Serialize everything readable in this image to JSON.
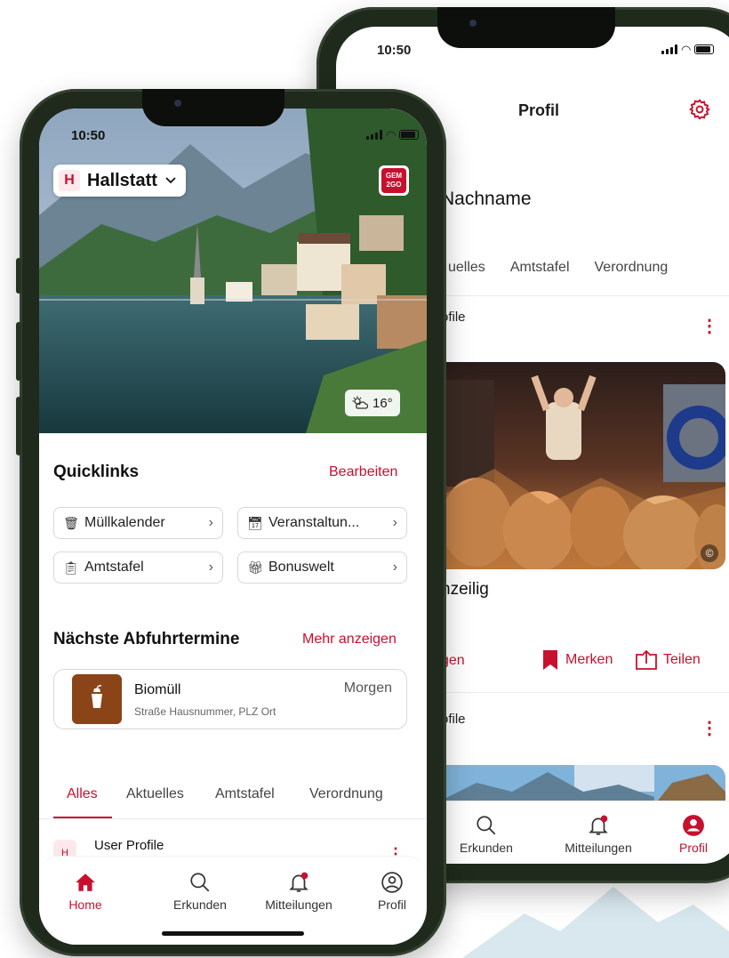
{
  "colors": {
    "accent": "#c8102e",
    "frame": "#1f2a1c",
    "waste_brown": "#8a4418"
  },
  "back_phone": {
    "status_time": "10:50",
    "header_title": "Profil",
    "name_partial": "Nachname",
    "comma_fragment": ",",
    "tabs": [
      "uelles",
      "Amtstafel",
      "Verordnung"
    ],
    "post1_label": "ofile",
    "post_headline": "nzeilig",
    "actions": {
      "left_partial": "gen",
      "bookmark_label": "Merken",
      "share_label": "Teilen"
    },
    "post2_label": "ofile",
    "copyright_symbol": "©",
    "nav": [
      {
        "label": "Erkunden",
        "icon": "search-icon"
      },
      {
        "label": "Mitteilungen",
        "icon": "bell-icon"
      },
      {
        "label": "Profil",
        "icon": "user-circle-icon"
      }
    ]
  },
  "front_phone": {
    "status_time": "10:50",
    "city": {
      "logo_letter": "H",
      "name": "Hallstatt"
    },
    "gem_badge": "GEM 2GO",
    "weather": "16°",
    "quicklinks": {
      "title": "Quicklinks",
      "edit_label": "Bearbeiten",
      "items": [
        {
          "label": "Müllkalender",
          "icon": "trash-icon"
        },
        {
          "label": "Veranstaltun...",
          "icon": "calendar-icon"
        },
        {
          "label": "Amtstafel",
          "icon": "clipboard-icon"
        },
        {
          "label": "Bonuswelt",
          "icon": "gift-icon"
        }
      ]
    },
    "pickup": {
      "title": "Nächste Abfuhrtermine",
      "more_label": "Mehr anzeigen",
      "item": {
        "name": "Biomüll",
        "address": "Straße Hausnummer, PLZ Ort",
        "when": "Morgen"
      }
    },
    "tabs": [
      "Alles",
      "Aktuelles",
      "Amtstafel",
      "Verordnung"
    ],
    "post": {
      "avatar_letter": "H",
      "label": "User Profile"
    },
    "nav": [
      {
        "label": "Home",
        "icon": "home-icon"
      },
      {
        "label": "Erkunden",
        "icon": "search-icon"
      },
      {
        "label": "Mitteilungen",
        "icon": "bell-icon"
      },
      {
        "label": "Profil",
        "icon": "user-circle-icon"
      }
    ]
  }
}
